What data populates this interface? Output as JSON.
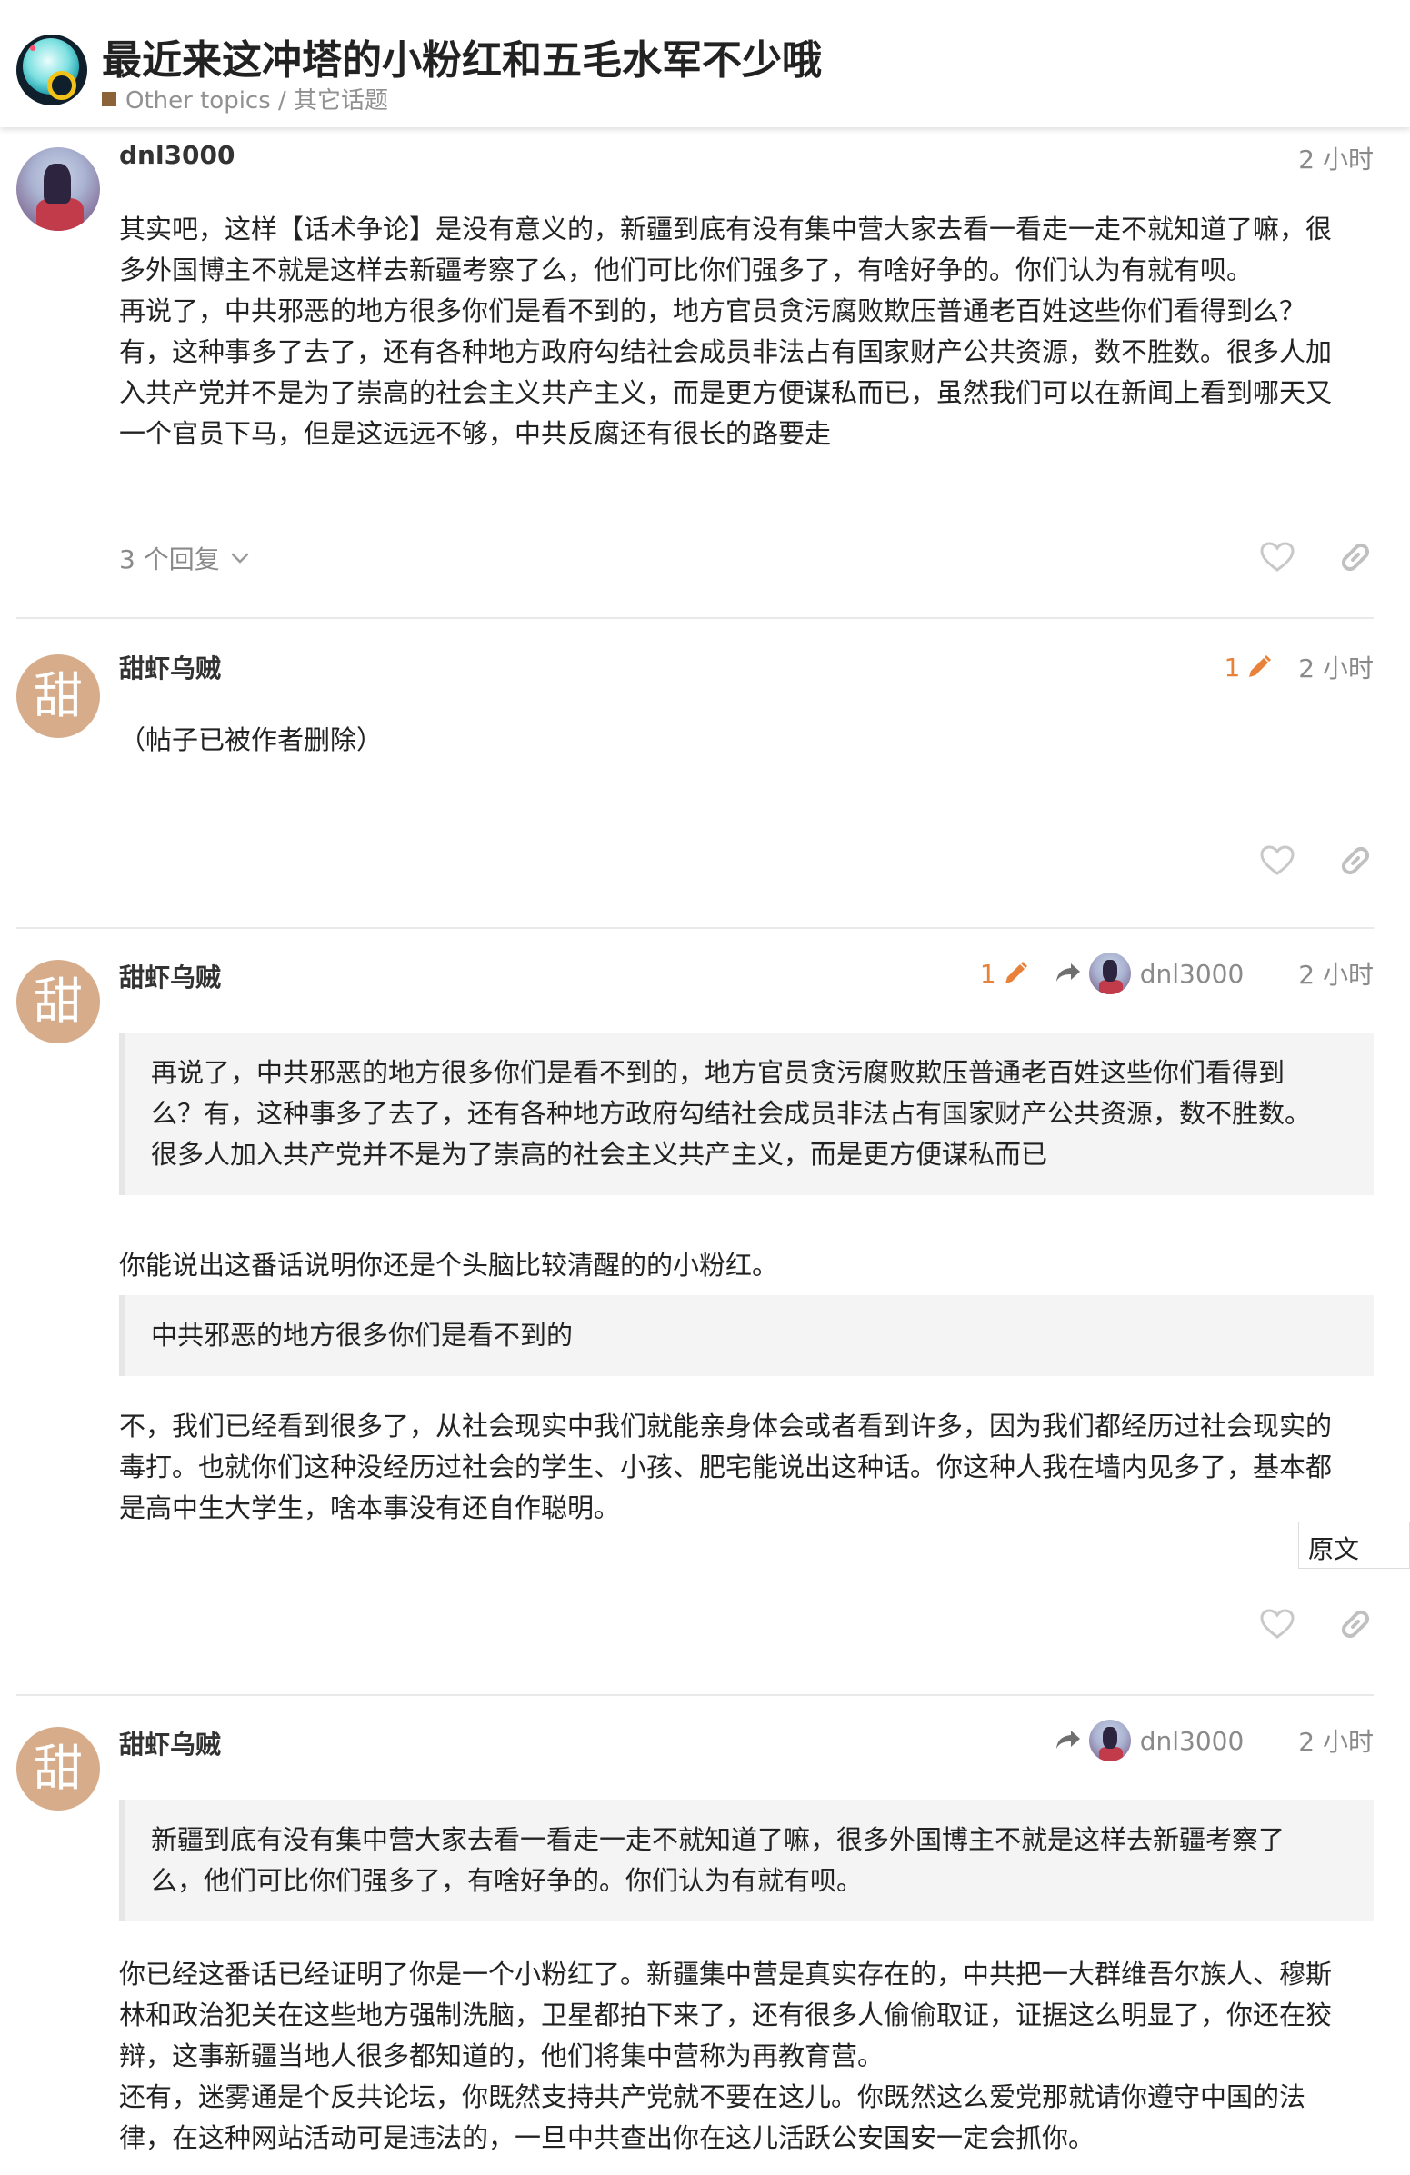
{
  "header": {
    "title": "最近来这冲塔的小粉红和五毛水军不少哦",
    "category": "Other topics / 其它话题",
    "category_color": "#8c6238"
  },
  "posts": [
    {
      "username": "dnl3000",
      "avatar": "photo-avatar",
      "time": "2 小时",
      "paragraphs": [
        "其实吧，这样【话术争论】是没有意义的，新疆到底有没有集中营大家去看一看走一走不就知道了嘛，很",
        "多外国博主不就是这样去新疆考察了么，他们可比你们强多了，有啥好争的。你们认为有就有呗。",
        "再说了，中共邪恶的地方很多你们是看不到的，地方官员贪污腐败欺压普通老百姓这些你们看得到么？",
        "有，这种事多了去了，还有各种地方政府勾结社会成员非法占有国家财产公共资源，数不胜数。很多人加",
        "入共产党并不是为了崇高的社会主义共产主义，而是更方便谋私而已，虽然我们可以在新闻上看到哪天又",
        "一个官员下马，但是这远远不够，中共反腐还有很长的路要走"
      ],
      "replies_label": "3 个回复"
    },
    {
      "username": "甜虾乌贼",
      "avatar_letter": "甜",
      "edit_count": "1",
      "time": "2 小时",
      "body": "（帖子已被作者删除）"
    },
    {
      "username": "甜虾乌贼",
      "avatar_letter": "甜",
      "edit_count": "1",
      "reply_to": "dnl3000",
      "time": "2 小时",
      "quote1": [
        "再说了，中共邪恶的地方很多你们是看不到的，地方官员贪污腐败欺压普通老百姓这些你们看得到",
        "么？有，这种事多了去了，还有各种地方政府勾结社会成员非法占有国家财产公共资源，数不胜数。",
        "很多人加入共产党并不是为了崇高的社会主义共产主义，而是更方便谋私而已"
      ],
      "text1": "你能说出这番话说明你还是个头脑比较清醒的的小粉红。",
      "quote2": "中共邪恶的地方很多你们是看不到的",
      "text2": [
        "不，我们已经看到很多了，从社会现实中我们就能亲身体会或者看到许多，因为我们都经历过社会现实的",
        "毒打。也就你们这种没经历过社会的学生、小孩、肥宅能说出这种话。你这种人我在墙内见多了，基本都",
        "是高中生大学生，啥本事没有还自作聪明。"
      ],
      "show_original": "原文"
    },
    {
      "username": "甜虾乌贼",
      "avatar_letter": "甜",
      "reply_to": "dnl3000",
      "time": "2 小时",
      "quote": [
        "新疆到底有没有集中营大家去看一看走一走不就知道了嘛，很多外国博主不就是这样去新疆考察了",
        "么，他们可比你们强多了，有啥好争的。你们认为有就有呗。"
      ],
      "text": [
        "你已经这番话已经证明了你是一个小粉红了。新疆集中营是真实存在的，中共把一大群维吾尔族人、穆斯",
        "林和政治犯关在这些地方强制洗脑，卫星都拍下来了，还有很多人偷偷取证，证据这么明显了，你还在狡",
        "辩，这事新疆当地人很多都知道的，他们将集中营称为再教育营。",
        "还有，迷雾通是个反共论坛，你既然支持共产党就不要在这儿。你既然这么爱党那就请你遵守中国的法",
        "律，在这种网站活动可是违法的，一旦中共查出你在这儿活跃公安国安一定会抓你。"
      ]
    }
  ],
  "colors": {
    "accent_orange": "#e8813a",
    "muted": "#8a8a8a",
    "quote_bg": "#f4f4f4",
    "avatar_letter_bg": "#d7ac8a"
  }
}
